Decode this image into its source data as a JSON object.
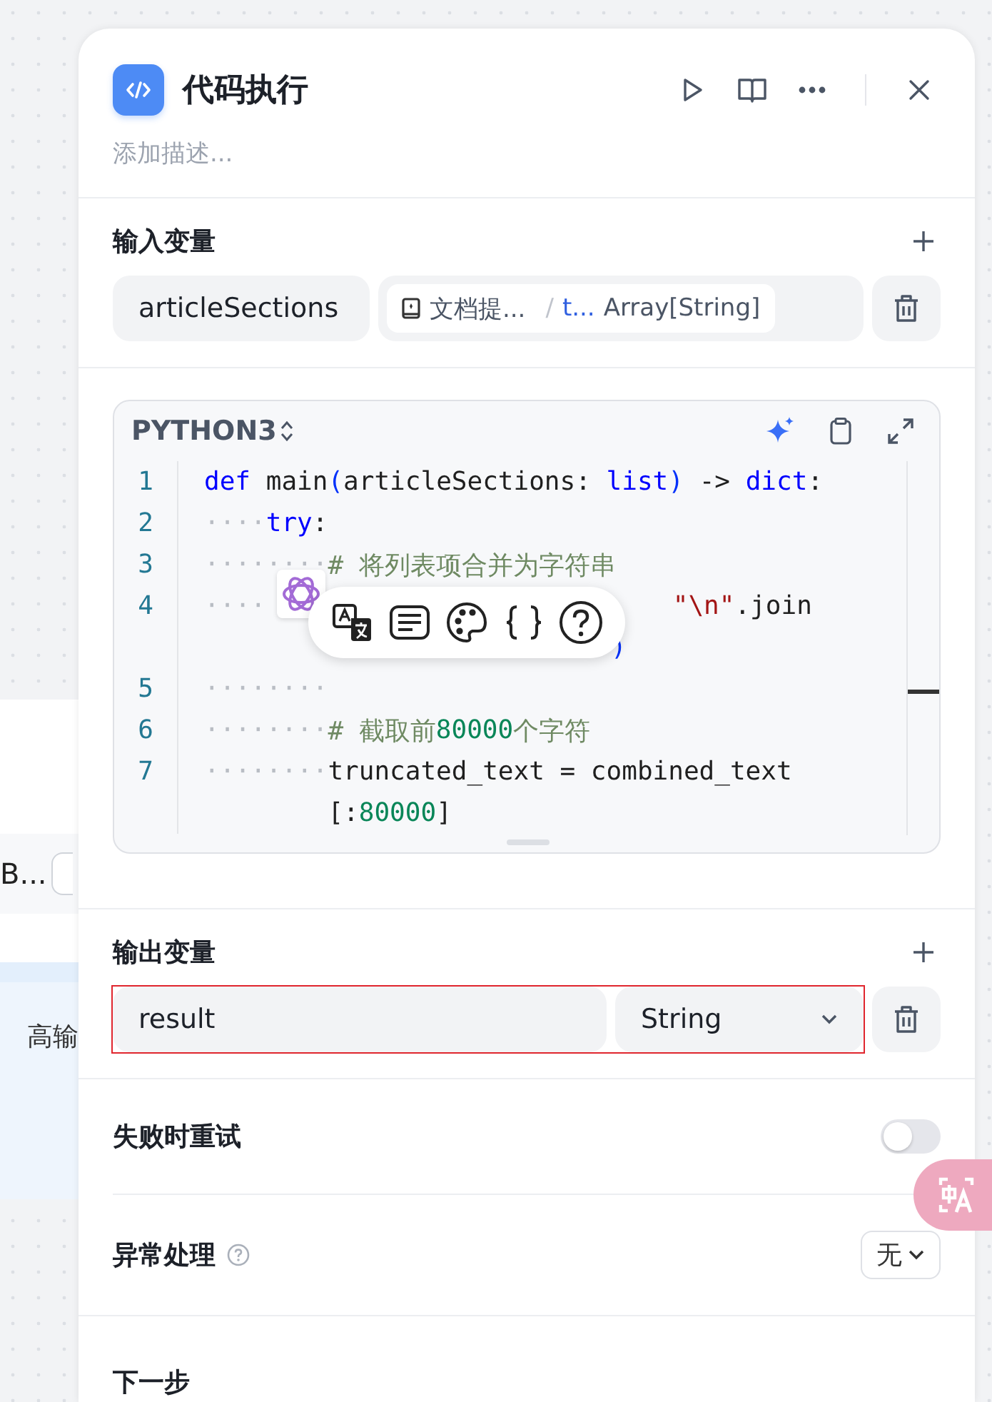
{
  "canvas_node": {
    "label": "B...",
    "body": "高输"
  },
  "panel": {
    "title": "代码执行",
    "description_placeholder": "添加描述..."
  },
  "input_variables": {
    "title": "输入变量",
    "items": [
      {
        "name": "articleSections",
        "source": "文档提...",
        "separator": "/",
        "field": "t...",
        "type": "Array[String]"
      }
    ]
  },
  "code": {
    "language": "PYTHON3",
    "lines": [
      {
        "number": "1",
        "tokens": [
          {
            "kind": "keyword",
            "text": "def"
          },
          {
            "kind": "plain",
            "text": " main"
          },
          {
            "kind": "paren",
            "text": "("
          },
          {
            "kind": "plain",
            "text": "articleSections: "
          },
          {
            "kind": "keyword",
            "text": "list"
          },
          {
            "kind": "paren",
            "text": ")"
          },
          {
            "kind": "plain",
            "text": " -> "
          },
          {
            "kind": "keyword",
            "text": "dict"
          },
          {
            "kind": "plain",
            "text": ":"
          }
        ]
      },
      {
        "number": "2",
        "tokens": [
          {
            "kind": "ws",
            "text": "····"
          },
          {
            "kind": "keyword",
            "text": "try"
          },
          {
            "kind": "plain",
            "text": ":"
          }
        ]
      },
      {
        "number": "3",
        "tokens": [
          {
            "kind": "ws",
            "text": "········"
          },
          {
            "kind": "comment",
            "text": "# 将列表项合并为字符串"
          }
        ]
      },
      {
        "number": "4",
        "tokens": [
          {
            "kind": "ws",
            "text": "····"
          },
          {
            "kind": "gap"
          },
          {
            "kind": "string",
            "text": "\"\\n\""
          },
          {
            "kind": "plain",
            "text": ".join"
          }
        ]
      },
      {
        "tokens": [
          {
            "kind": "gap"
          },
          {
            "kind": "paren",
            "text": ")"
          }
        ]
      },
      {
        "number": "5",
        "tokens": [
          {
            "kind": "ws",
            "text": "········"
          }
        ]
      },
      {
        "number": "6",
        "tokens": [
          {
            "kind": "ws",
            "text": "········"
          },
          {
            "kind": "comment",
            "text": "# 截取前"
          },
          {
            "kind": "number",
            "text": "80000"
          },
          {
            "kind": "comment",
            "text": "个字符"
          }
        ]
      },
      {
        "number": "7",
        "tokens": [
          {
            "kind": "ws",
            "text": "········"
          },
          {
            "kind": "plain",
            "text": "truncated_text = combined_text"
          }
        ]
      },
      {
        "tokens": [
          {
            "kind": "indent"
          },
          {
            "kind": "plain",
            "text": "[:"
          },
          {
            "kind": "number",
            "text": "80000"
          },
          {
            "kind": "plain",
            "text": "]"
          }
        ]
      }
    ]
  },
  "output_variables": {
    "title": "输出变量",
    "items": [
      {
        "name": "result",
        "type": "String",
        "highlighted": true
      }
    ]
  },
  "retry": {
    "label": "失败时重试",
    "on": false
  },
  "error_handling": {
    "label": "异常处理",
    "value": "无"
  },
  "next_step": {
    "label": "下一步"
  }
}
